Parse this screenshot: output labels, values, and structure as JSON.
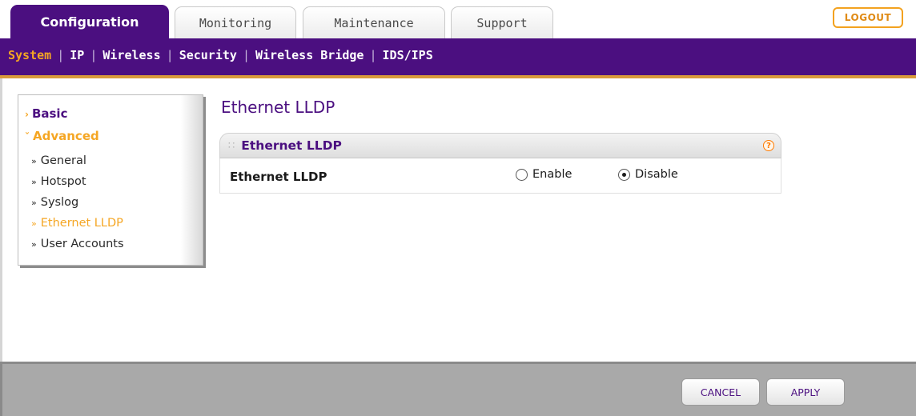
{
  "tabs": [
    {
      "label": "Configuration",
      "active": true
    },
    {
      "label": "Monitoring",
      "active": false
    },
    {
      "label": "Maintenance",
      "active": false
    },
    {
      "label": "Support",
      "active": false
    }
  ],
  "header": {
    "logout_label": "LOGOUT"
  },
  "subnav": {
    "items": [
      {
        "label": "System",
        "active": true
      },
      {
        "label": "IP",
        "active": false
      },
      {
        "label": "Wireless",
        "active": false
      },
      {
        "label": "Security",
        "active": false
      },
      {
        "label": "Wireless Bridge",
        "active": false
      },
      {
        "label": "IDS/IPS",
        "active": false
      }
    ]
  },
  "sidebar": {
    "basic_label": "Basic",
    "advanced_label": "Advanced",
    "advanced_items": [
      {
        "label": "General",
        "active": false
      },
      {
        "label": "Hotspot",
        "active": false
      },
      {
        "label": "Syslog",
        "active": false
      },
      {
        "label": "Ethernet LLDP",
        "active": true
      },
      {
        "label": "User Accounts",
        "active": false
      }
    ]
  },
  "main": {
    "page_title": "Ethernet LLDP",
    "panel": {
      "title": "Ethernet LLDP",
      "help_icon": "question-mark-icon",
      "field_label": "Ethernet LLDP",
      "options": [
        "Enable",
        "Disable"
      ],
      "selected": "Disable"
    }
  },
  "footer": {
    "cancel_label": "CANCEL",
    "apply_label": "APPLY"
  },
  "colors": {
    "brand_purple": "#4b0f80",
    "accent_orange": "#f5a623",
    "footer_gray": "#a9a9a9"
  }
}
